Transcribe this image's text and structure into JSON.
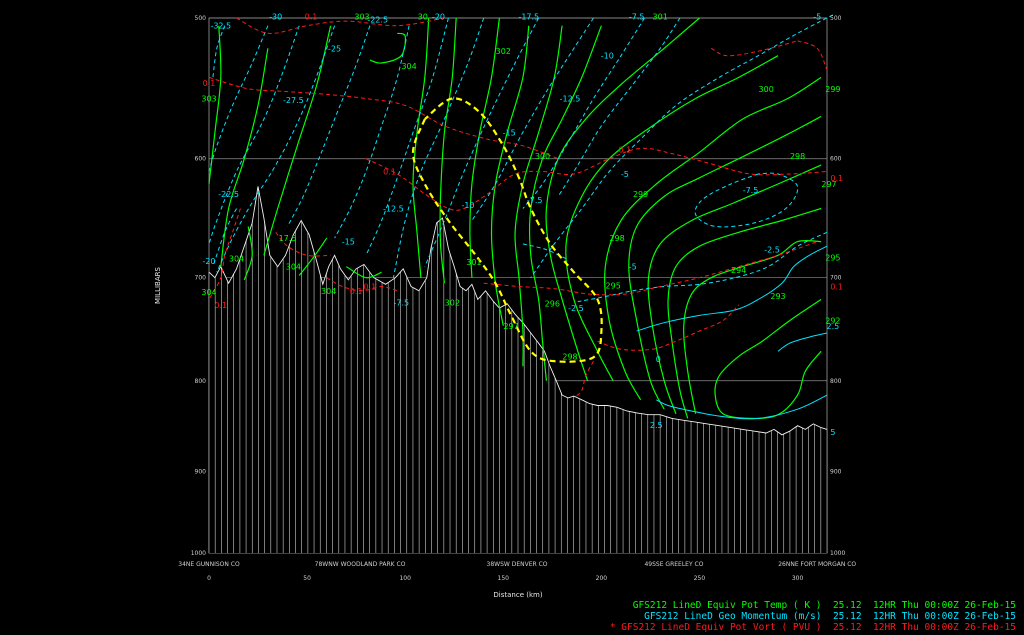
{
  "chart_data": {
    "type": "cross-section",
    "ylabel": "MILLIBARS",
    "xlabel": "Distance (km)",
    "y_scale": "log-pressure",
    "ylim": [
      1000,
      500
    ],
    "xlim": [
      0,
      315
    ],
    "pressure_ticks": [
      500,
      600,
      700,
      800,
      900,
      1000
    ],
    "distance_ticks": [
      0,
      50,
      100,
      150,
      200,
      250,
      300
    ],
    "locations": [
      {
        "label": "34NE GUNNISON CO",
        "km": 0
      },
      {
        "label": "78WNW WOODLAND PARK CO",
        "km": 77
      },
      {
        "label": "38WSW DENVER CO",
        "km": 157
      },
      {
        "label": "49SSE GREELEY CO",
        "km": 237
      },
      {
        "label": "26NNE FORT MORGAN CO",
        "km": 310
      }
    ],
    "series": [
      {
        "name": "GFS212 LineD Equiv Pot Temp ( K )",
        "color": "#00ff00",
        "style": "solid"
      },
      {
        "name": "GFS212 LineD Geo Momentum (m/s)",
        "color": "#00e5ff",
        "style": "dashed"
      },
      {
        "name": "GFS212 LineD Equiv Pot Vort ( PVU )",
        "color": "#ff1a1a",
        "style": "dashed"
      }
    ],
    "highlight_color": "#ffff00",
    "terrain_pressure": [
      [
        0,
        695
      ],
      [
        3,
        700
      ],
      [
        6,
        690
      ],
      [
        10,
        705
      ],
      [
        14,
        692
      ],
      [
        18,
        672
      ],
      [
        22,
        652
      ],
      [
        25,
        622
      ],
      [
        28,
        648
      ],
      [
        31,
        680
      ],
      [
        35,
        690
      ],
      [
        39,
        680
      ],
      [
        43,
        662
      ],
      [
        47,
        650
      ],
      [
        51,
        662
      ],
      [
        55,
        686
      ],
      [
        58,
        706
      ],
      [
        61,
        690
      ],
      [
        64,
        680
      ],
      [
        67,
        692
      ],
      [
        71,
        702
      ],
      [
        75,
        692
      ],
      [
        79,
        688
      ],
      [
        84,
        700
      ],
      [
        90,
        706
      ],
      [
        95,
        700
      ],
      [
        99,
        692
      ],
      [
        103,
        708
      ],
      [
        107,
        712
      ],
      [
        111,
        700
      ],
      [
        113,
        675
      ],
      [
        116,
        652
      ],
      [
        119,
        648
      ],
      [
        122,
        674
      ],
      [
        125,
        690
      ],
      [
        128,
        708
      ],
      [
        131,
        712
      ],
      [
        134,
        706
      ],
      [
        137,
        720
      ],
      [
        141,
        712
      ],
      [
        145,
        722
      ],
      [
        148,
        728
      ],
      [
        152,
        724
      ],
      [
        156,
        734
      ],
      [
        160,
        742
      ],
      [
        164,
        752
      ],
      [
        168,
        762
      ],
      [
        171,
        770
      ],
      [
        174,
        786
      ],
      [
        177,
        800
      ],
      [
        180,
        815
      ],
      [
        183,
        818
      ],
      [
        186,
        816
      ],
      [
        190,
        820
      ],
      [
        194,
        824
      ],
      [
        198,
        826
      ],
      [
        203,
        826
      ],
      [
        208,
        828
      ],
      [
        213,
        832
      ],
      [
        218,
        834
      ],
      [
        224,
        836
      ],
      [
        230,
        836
      ],
      [
        236,
        840
      ],
      [
        242,
        842
      ],
      [
        248,
        844
      ],
      [
        254,
        846
      ],
      [
        260,
        848
      ],
      [
        266,
        850
      ],
      [
        272,
        852
      ],
      [
        278,
        854
      ],
      [
        284,
        856
      ],
      [
        288,
        852
      ],
      [
        292,
        858
      ],
      [
        296,
        854
      ],
      [
        300,
        848
      ],
      [
        304,
        852
      ],
      [
        308,
        846
      ],
      [
        312,
        850
      ],
      [
        315,
        852
      ]
    ],
    "contour_labels": {
      "theta_e": [
        {
          "text": "303",
          "km": 0,
          "p": 555
        },
        {
          "text": "304",
          "km": 102,
          "p": 532
        },
        {
          "text": "302",
          "km": 150,
          "p": 522
        },
        {
          "text": "300",
          "km": 170,
          "p": 598
        },
        {
          "text": "299",
          "km": 220,
          "p": 628
        },
        {
          "text": "298",
          "km": 208,
          "p": 665
        },
        {
          "text": "295",
          "km": 206,
          "p": 707
        },
        {
          "text": "294",
          "km": 270,
          "p": 693
        },
        {
          "text": "293",
          "km": 290,
          "p": 717
        },
        {
          "text": "292",
          "km": 318,
          "p": 740
        },
        {
          "text": "295",
          "km": 318,
          "p": 682
        },
        {
          "text": "297",
          "km": 316,
          "p": 620
        },
        {
          "text": "298",
          "km": 300,
          "p": 598
        },
        {
          "text": "299",
          "km": 318,
          "p": 548
        },
        {
          "text": "300",
          "km": 284,
          "p": 548
        },
        {
          "text": "301",
          "km": 135,
          "p": 686
        },
        {
          "text": "302",
          "km": 124,
          "p": 723
        },
        {
          "text": "304",
          "km": 0,
          "p": 713
        },
        {
          "text": "304",
          "km": 14,
          "p": 683
        },
        {
          "text": "304",
          "km": 43,
          "p": 690
        },
        {
          "text": "304",
          "km": 61,
          "p": 712
        },
        {
          "text": "303",
          "km": 78,
          "p": 499
        },
        {
          "text": "30",
          "km": 109,
          "p": 499
        },
        {
          "text": "301",
          "km": 230,
          "p": 499
        },
        {
          "text": "296",
          "km": 175,
          "p": 724
        },
        {
          "text": "297",
          "km": 154,
          "p": 745
        },
        {
          "text": "298",
          "km": 184,
          "p": 775
        },
        {
          "text": "17.5",
          "km": 40,
          "p": 665
        }
      ],
      "momentum": [
        {
          "text": "-32.5",
          "km": 6,
          "p": 505
        },
        {
          "text": "-30",
          "km": 34,
          "p": 499
        },
        {
          "text": "-22.5",
          "km": 86,
          "p": 501
        },
        {
          "text": "-20",
          "km": 117,
          "p": 499
        },
        {
          "text": "-17.5",
          "km": 163,
          "p": 499
        },
        {
          "text": "-7.5",
          "km": 218,
          "p": 499
        },
        {
          "text": "-5",
          "km": 310,
          "p": 499
        },
        {
          "text": "-27.5",
          "km": 43,
          "p": 556
        },
        {
          "text": "-25",
          "km": 64,
          "p": 520
        },
        {
          "text": "-10",
          "km": 203,
          "p": 525
        },
        {
          "text": "-12.5",
          "km": 184,
          "p": 555
        },
        {
          "text": "-15",
          "km": 153,
          "p": 580
        },
        {
          "text": "-22.5",
          "km": 10,
          "p": 628
        },
        {
          "text": "-15",
          "km": 71,
          "p": 668
        },
        {
          "text": "-12.5",
          "km": 94,
          "p": 640
        },
        {
          "text": "-10",
          "km": 132,
          "p": 637
        },
        {
          "text": "-7.5",
          "km": 166,
          "p": 633
        },
        {
          "text": "-5",
          "km": 212,
          "p": 612
        },
        {
          "text": "-7.5",
          "km": 276,
          "p": 625
        },
        {
          "text": "-2.5",
          "km": 287,
          "p": 675
        },
        {
          "text": "-5",
          "km": 216,
          "p": 690
        },
        {
          "text": "-2.5",
          "km": 187,
          "p": 728
        },
        {
          "text": "-7.5",
          "km": 98,
          "p": 723
        },
        {
          "text": "-20",
          "km": 0,
          "p": 685
        },
        {
          "text": "0",
          "km": 229,
          "p": 778
        },
        {
          "text": "2.5",
          "km": 228,
          "p": 847
        },
        {
          "text": "2.5",
          "km": 318,
          "p": 745
        },
        {
          "text": "5",
          "km": 318,
          "p": 855
        }
      ],
      "pv": [
        {
          "text": "0.1",
          "km": 52,
          "p": 499
        },
        {
          "text": "0.1",
          "km": 0,
          "p": 544
        },
        {
          "text": "0.1",
          "km": 92,
          "p": 610
        },
        {
          "text": "0.1",
          "km": 212,
          "p": 593
        },
        {
          "text": "0.1",
          "km": 320,
          "p": 615
        },
        {
          "text": "0.1",
          "km": 320,
          "p": 708
        },
        {
          "text": "0.1",
          "km": 75,
          "p": 712
        },
        {
          "text": "0.1",
          "km": 6,
          "p": 725
        },
        {
          "text": "0.1",
          "km": 82,
          "p": 708
        }
      ]
    }
  },
  "legend": {
    "entries": [
      {
        "name": "GFS212 LineD Equiv Pot Temp ( K )",
        "value": "25.12",
        "valid": "12HR Thu 00:00Z 26-Feb-15",
        "color": "#00ff00",
        "marker": ""
      },
      {
        "name": "GFS212 LineD Geo Momentum (m/s)",
        "value": "25.12",
        "valid": "12HR Thu 00:00Z 26-Feb-15",
        "color": "#00e5ff",
        "marker": ""
      },
      {
        "name": "GFS212 LineD Equiv Pot Vort ( PVU )",
        "value": "25.12",
        "valid": "12HR Thu 00:00Z 26-Feb-15",
        "color": "#ff1a1a",
        "marker": "*"
      }
    ]
  }
}
